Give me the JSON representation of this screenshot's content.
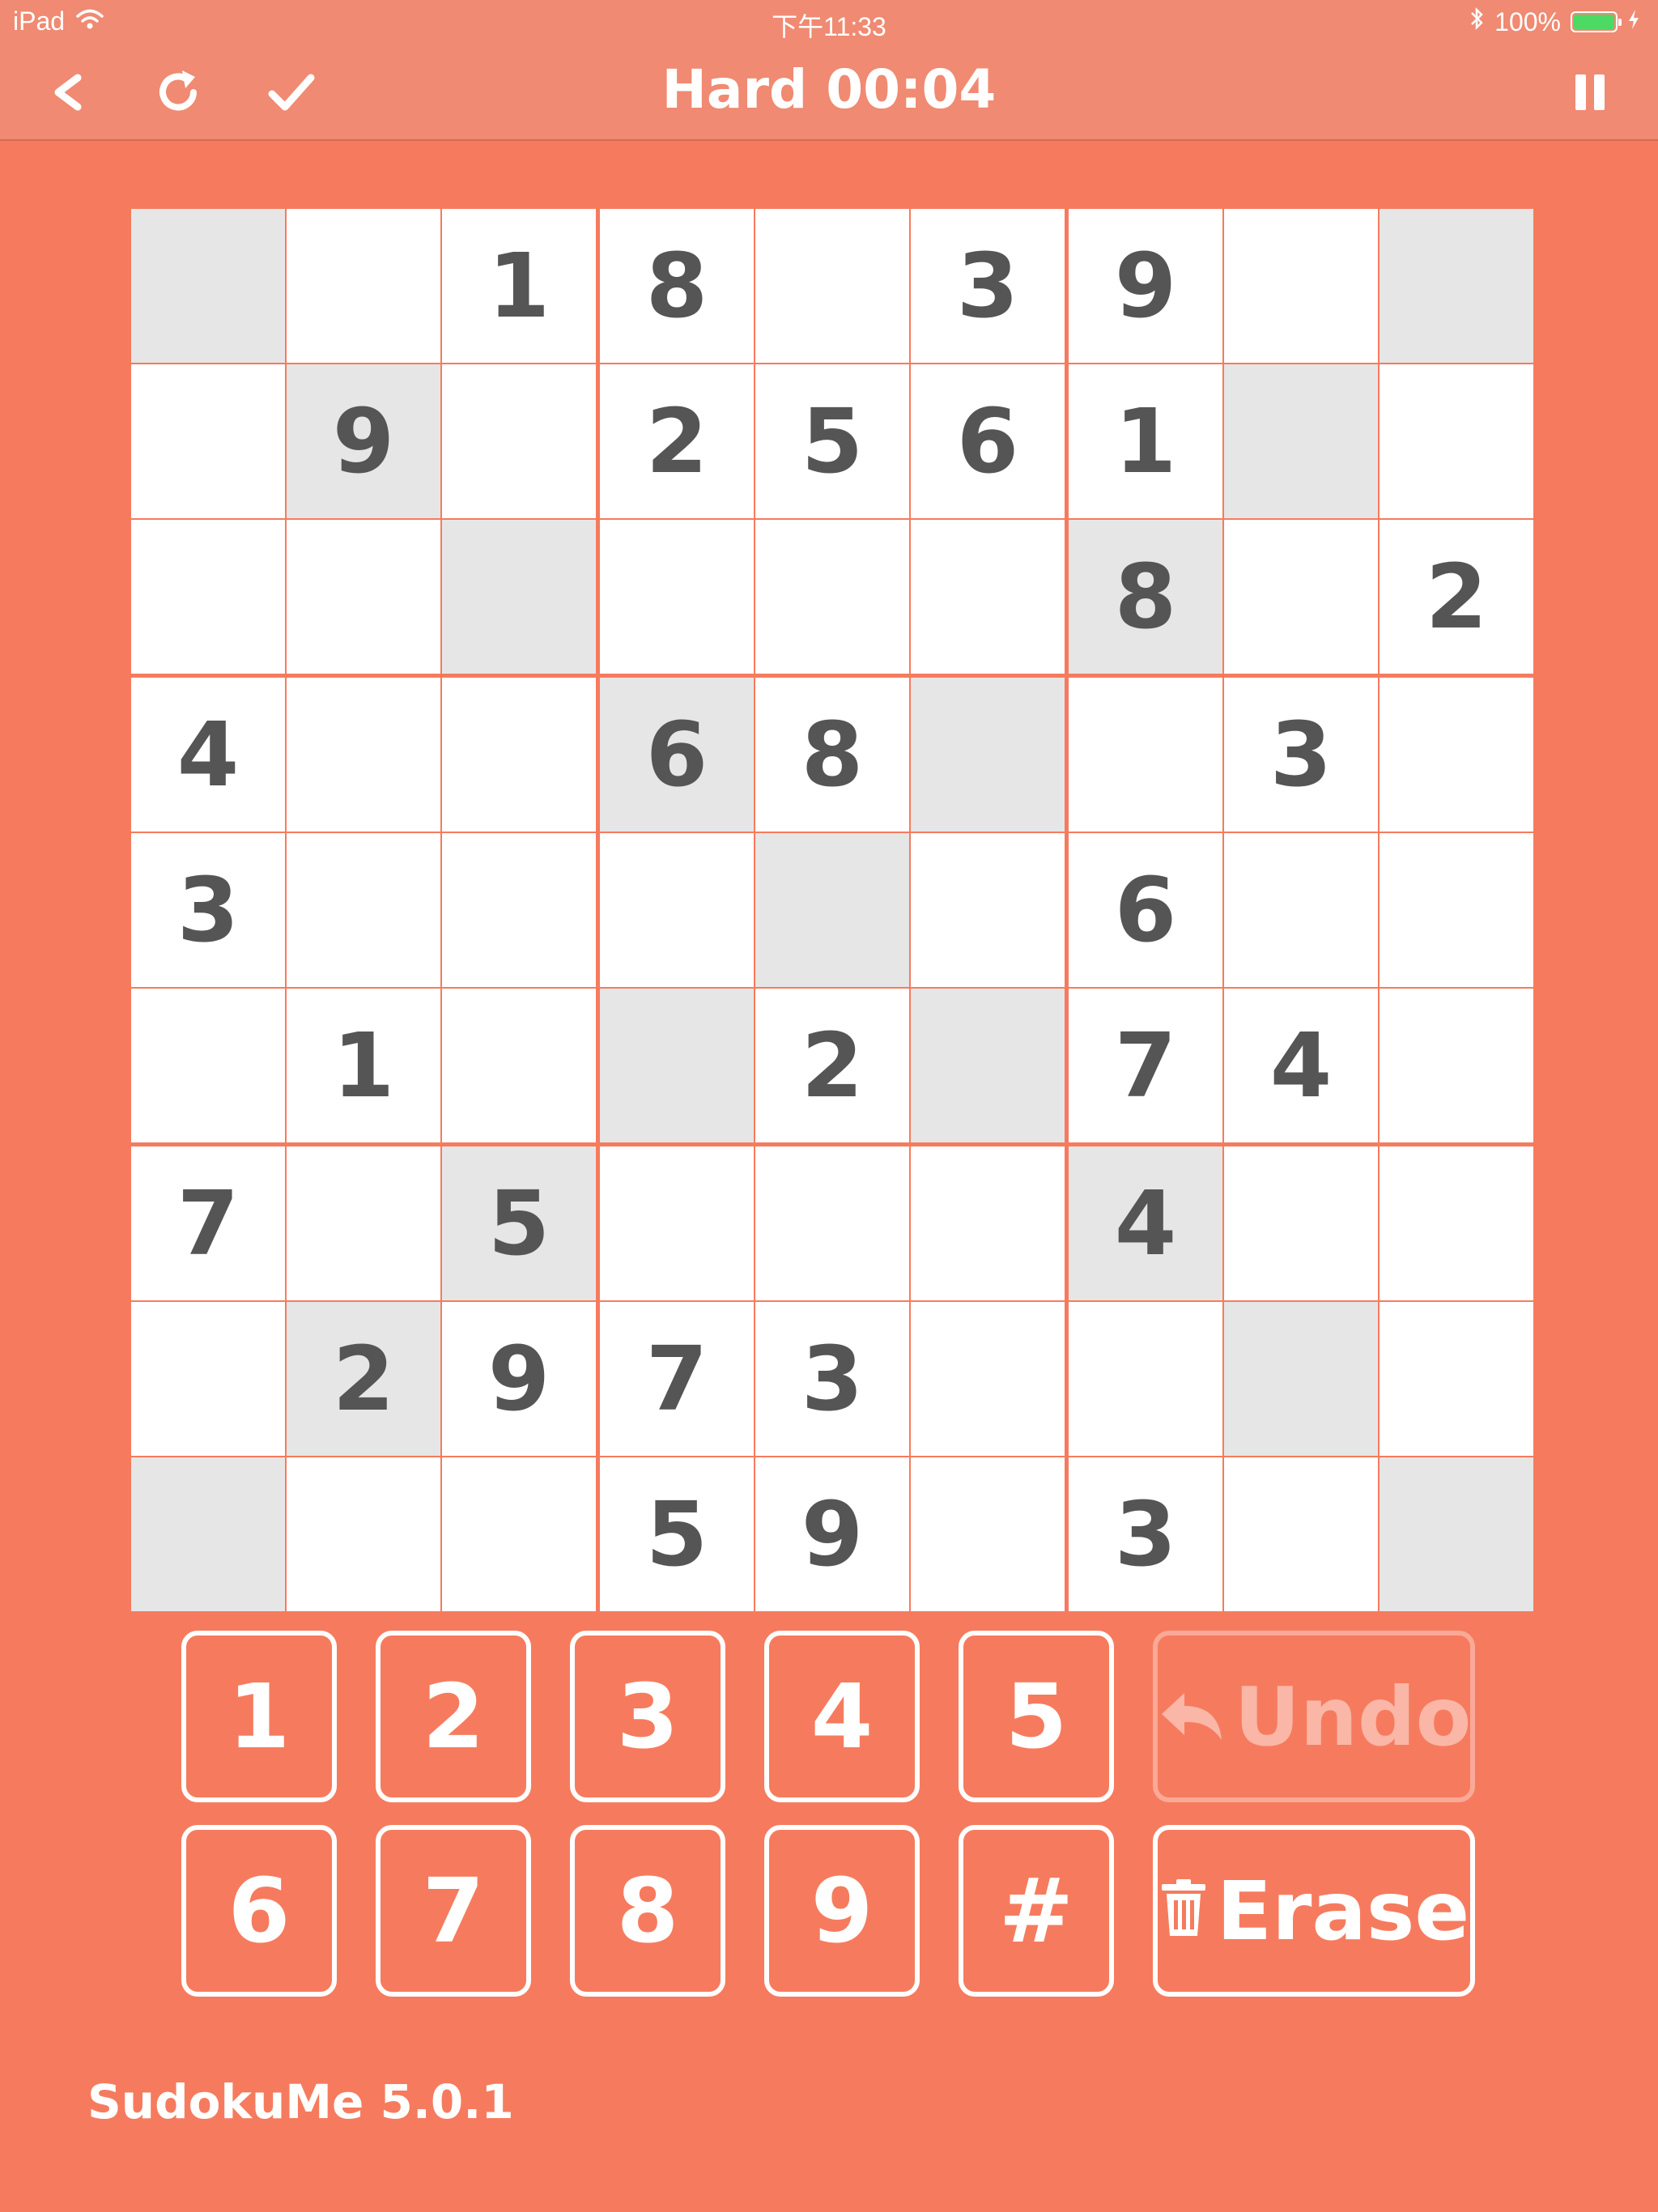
{
  "status": {
    "device": "iPad",
    "time": "下午11:33",
    "battery": "100%"
  },
  "nav": {
    "title": "Hard 00:04",
    "icons": [
      "back-icon",
      "restart-icon",
      "check-icon",
      "pause-icon"
    ]
  },
  "board": {
    "cells": [
      [
        "",
        "",
        "1",
        "8",
        "",
        "3",
        "9",
        "",
        ""
      ],
      [
        "",
        "9",
        "",
        "2",
        "5",
        "6",
        "1",
        "",
        ""
      ],
      [
        "",
        "",
        "",
        "",
        "",
        "",
        "8",
        "",
        "2"
      ],
      [
        "4",
        "",
        "",
        "6",
        "8",
        "",
        "",
        "3",
        ""
      ],
      [
        "3",
        "",
        "",
        "",
        "",
        "",
        "6",
        "",
        ""
      ],
      [
        "",
        "1",
        "",
        "",
        "2",
        "",
        "7",
        "4",
        ""
      ],
      [
        "7",
        "",
        "5",
        "",
        "",
        "",
        "4",
        "",
        ""
      ],
      [
        "",
        "2",
        "9",
        "7",
        "3",
        "",
        "",
        "",
        ""
      ],
      [
        "",
        "",
        "",
        "5",
        "9",
        "",
        "3",
        "",
        ""
      ]
    ],
    "shaded": [
      [
        0,
        0
      ],
      [
        0,
        8
      ],
      [
        1,
        1
      ],
      [
        1,
        7
      ],
      [
        2,
        2
      ],
      [
        2,
        6
      ],
      [
        3,
        3
      ],
      [
        3,
        5
      ],
      [
        4,
        4
      ],
      [
        5,
        3
      ],
      [
        5,
        5
      ],
      [
        6,
        2
      ],
      [
        6,
        6
      ],
      [
        7,
        1
      ],
      [
        7,
        7
      ],
      [
        8,
        0
      ],
      [
        8,
        8
      ]
    ],
    "colors": {
      "shade": "#E6E6E6",
      "digit": "#555555",
      "background": "#F67B5E"
    }
  },
  "keypad": {
    "row1": [
      "1",
      "2",
      "3",
      "4",
      "5"
    ],
    "row2": [
      "6",
      "7",
      "8",
      "9",
      "#"
    ],
    "undo_label": "Undo",
    "erase_label": "Erase"
  },
  "footer": {
    "app_version": "SudokuMe 5.0.1"
  }
}
